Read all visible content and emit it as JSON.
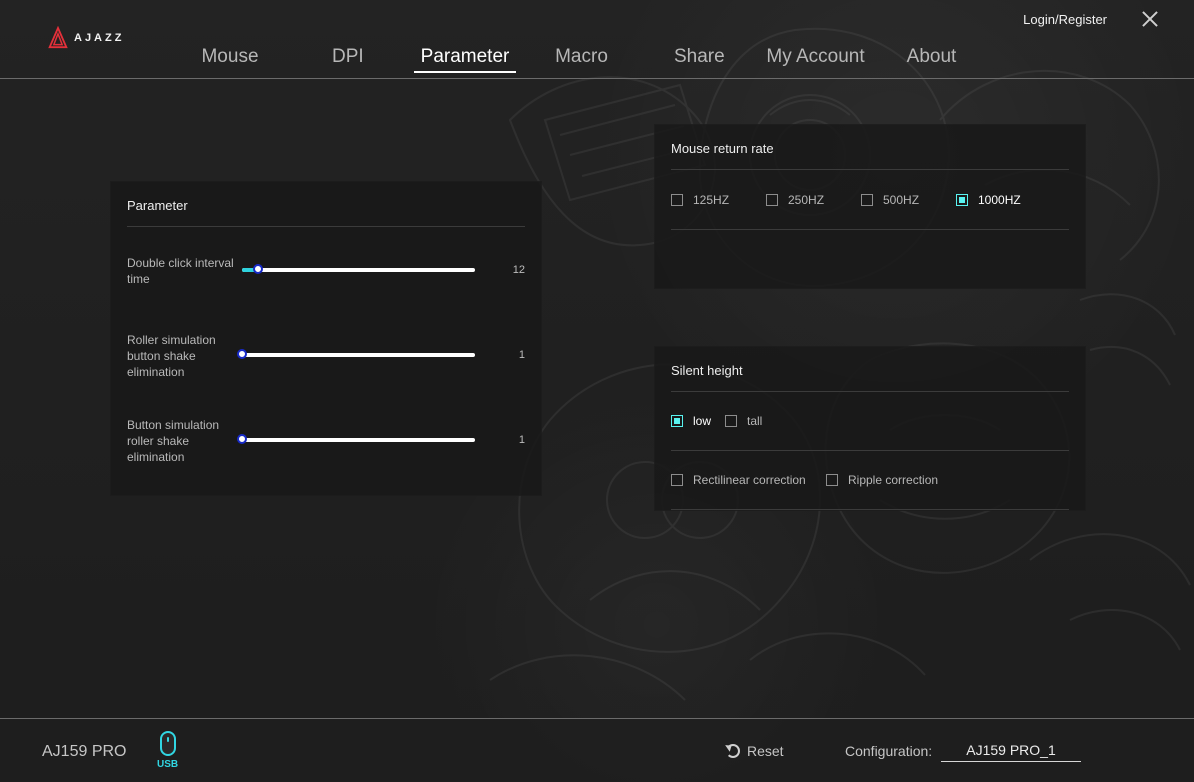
{
  "brand": {
    "name": "AJAZZ",
    "logo_icon": "ajazz-logo-icon",
    "accent_color": "#31d6e2"
  },
  "header": {
    "tabs": [
      {
        "label": "Mouse",
        "active": false
      },
      {
        "label": "DPI",
        "active": false
      },
      {
        "label": "Parameter",
        "active": true
      },
      {
        "label": "Macro",
        "active": false
      },
      {
        "label": "Share",
        "active": false
      },
      {
        "label": "My Account",
        "active": false
      },
      {
        "label": "About",
        "active": false
      }
    ],
    "login_register": "Login/Register",
    "close_icon": "close-icon"
  },
  "parameter_panel": {
    "title": "Parameter",
    "sliders": [
      {
        "label": "Double click interval time",
        "value": "12",
        "fraction": 0.07
      },
      {
        "label": "Roller simulation button shake elimination",
        "value": "1",
        "fraction": 0.0
      },
      {
        "label": "Button simulation roller shake elimination",
        "value": "1",
        "fraction": 0.0
      }
    ]
  },
  "return_rate_panel": {
    "title": "Mouse return rate",
    "options": [
      {
        "label": "125HZ",
        "checked": false
      },
      {
        "label": "250HZ",
        "checked": false
      },
      {
        "label": "500HZ",
        "checked": false
      },
      {
        "label": "1000HZ",
        "checked": true
      }
    ]
  },
  "silent_height_panel": {
    "title": "Silent height",
    "height_options": [
      {
        "label": "low",
        "checked": true
      },
      {
        "label": "tall",
        "checked": false
      }
    ],
    "correction_options": [
      {
        "label": "Rectilinear correction",
        "checked": false
      },
      {
        "label": "Ripple correction",
        "checked": false
      }
    ]
  },
  "footer": {
    "device_name": "AJ159 PRO",
    "connection_icon": "mouse-icon",
    "connection_label": "USB",
    "reset_label": "Reset",
    "reset_icon": "reset-icon",
    "configuration_label": "Configuration:",
    "configuration_value": "AJ159 PRO_1"
  }
}
